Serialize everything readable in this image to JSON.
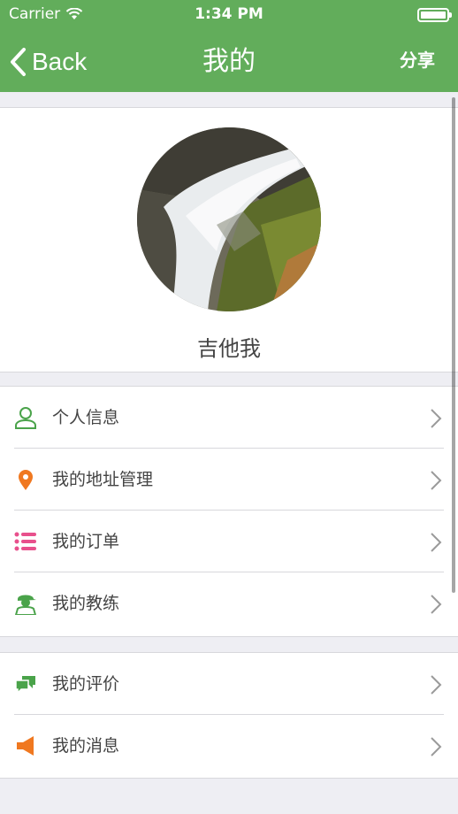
{
  "status_bar": {
    "carrier": "Carrier",
    "time": "1:34 PM"
  },
  "nav": {
    "back_label": "Back",
    "title": "我的",
    "share_label": "分享"
  },
  "profile": {
    "username": "吉他我"
  },
  "menu_group_1": [
    {
      "label": "个人信息",
      "icon": "user-outline-icon"
    },
    {
      "label": "我的地址管理",
      "icon": "location-pin-icon"
    },
    {
      "label": "我的订单",
      "icon": "list-icon"
    },
    {
      "label": "我的教练",
      "icon": "coach-icon"
    }
  ],
  "menu_group_2": [
    {
      "label": "我的评价",
      "icon": "chat-bubbles-icon"
    },
    {
      "label": "我的消息",
      "icon": "megaphone-icon"
    }
  ],
  "colors": {
    "nav_green": "#62ad5b",
    "pin_orange": "#f07820",
    "list_pink": "#e8508c",
    "coach_green": "#4aa34a",
    "megaphone_orange": "#f07820"
  }
}
